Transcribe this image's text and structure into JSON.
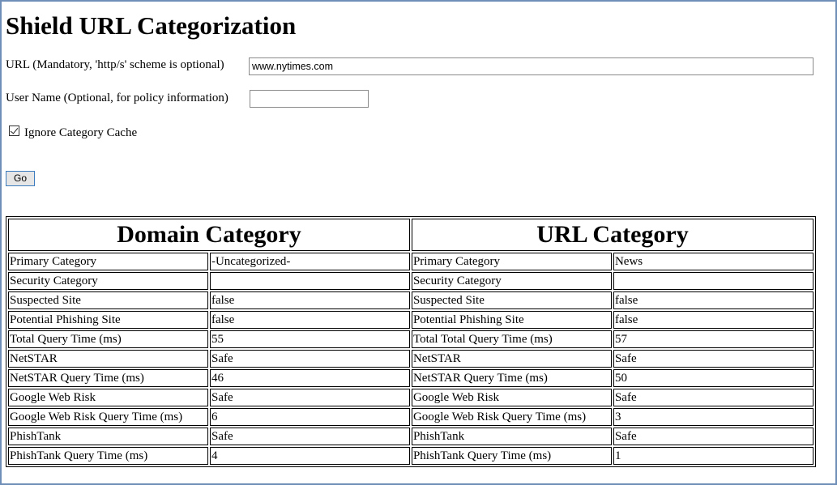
{
  "page": {
    "title": "Shield URL Categorization"
  },
  "form": {
    "url_label": "URL (Mandatory, 'http/s' scheme is optional)",
    "url_value": "www.nytimes.com",
    "user_label": "User Name (Optional, for policy information)",
    "user_value": "",
    "ignore_cache_label": "Ignore Category Cache",
    "ignore_cache_checked": true,
    "go_label": "Go"
  },
  "results": {
    "domain_header": "Domain Category",
    "url_header": "URL Category",
    "rows": [
      {
        "domain_label": "Primary Category",
        "domain_value": "-Uncategorized-",
        "url_label": "Primary Category",
        "url_value": "News"
      },
      {
        "domain_label": "Security Category",
        "domain_value": "",
        "url_label": "Security Category",
        "url_value": ""
      },
      {
        "domain_label": "Suspected Site",
        "domain_value": "false",
        "url_label": "Suspected Site",
        "url_value": "false"
      },
      {
        "domain_label": "Potential Phishing Site",
        "domain_value": "false",
        "url_label": "Potential Phishing Site",
        "url_value": "false"
      },
      {
        "domain_label": "Total Query Time (ms)",
        "domain_value": "55",
        "url_label": "Total Total Query Time (ms)",
        "url_value": "57"
      },
      {
        "domain_label": "NetSTAR",
        "domain_value": "Safe",
        "url_label": "NetSTAR",
        "url_value": "Safe"
      },
      {
        "domain_label": "NetSTAR Query Time (ms)",
        "domain_value": "46",
        "url_label": "NetSTAR Query Time (ms)",
        "url_value": "50"
      },
      {
        "domain_label": "Google Web Risk",
        "domain_value": "Safe",
        "url_label": "Google Web Risk",
        "url_value": "Safe"
      },
      {
        "domain_label": "Google Web Risk Query Time (ms)",
        "domain_value": "6",
        "url_label": "Google Web Risk Query Time (ms)",
        "url_value": "3"
      },
      {
        "domain_label": "PhishTank",
        "domain_value": "Safe",
        "url_label": "PhishTank",
        "url_value": "Safe"
      },
      {
        "domain_label": "PhishTank Query Time (ms)",
        "domain_value": "4",
        "url_label": "PhishTank Query Time (ms)",
        "url_value": "1"
      }
    ]
  },
  "colors": {
    "frame_border": "#6f8fb8",
    "button_border": "#3d7bbf"
  }
}
